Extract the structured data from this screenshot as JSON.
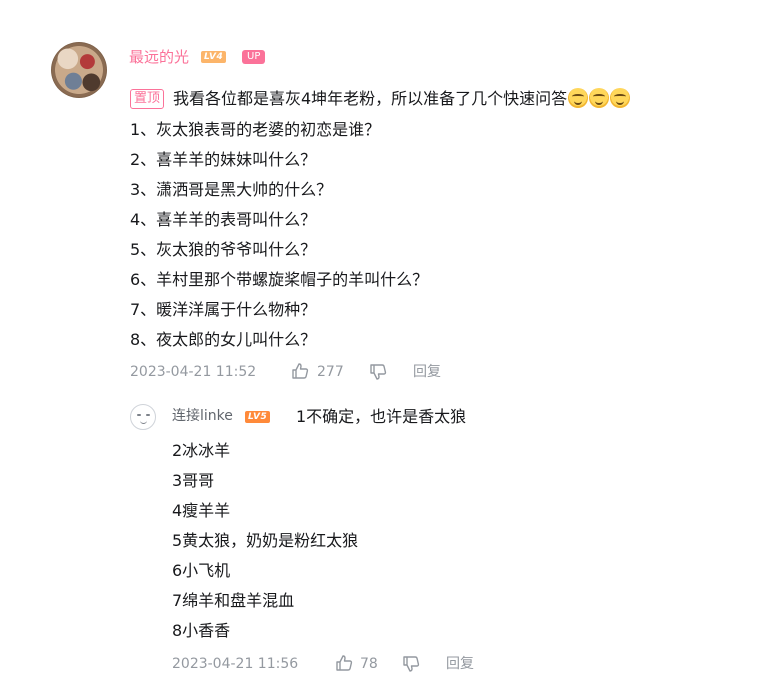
{
  "comment": {
    "username": "最远的光",
    "level": "LV4",
    "up_badge": "UP",
    "pin_label": "置顶",
    "text_lines": [
      "我看各位都是喜灰4坤年老粉，所以准备了几个快速问答",
      "1、灰太狼表哥的老婆的初恋是谁？",
      "2、喜羊羊的妹妹叫什么？",
      "3、潇洒哥是黑大帅的什么？",
      "4、喜羊羊的表哥叫什么？",
      "5、灰太狼的爷爷叫什么？",
      "6、羊村里那个带螺旋桨帽子的羊叫什么？",
      "7、暖洋洋属于什么物种？",
      "8、夜太郎的女儿叫什么？"
    ],
    "timestamp": "2023-04-21 11:52",
    "likes": "277",
    "reply_label": "回复"
  },
  "reply": {
    "username": "连接linke",
    "level": "LV5",
    "text_lines": [
      "1不确定，也许是香太狼",
      "2冰冰羊",
      "3哥哥",
      "4瘦羊羊",
      "5黄太狼，奶奶是粉红太狼",
      "6小飞机",
      "7绵羊和盘羊混血",
      "8小香香"
    ],
    "timestamp": "2023-04-21 11:56",
    "likes": "78",
    "reply_label": "回复"
  },
  "icons": {
    "emoji": "grinning-face-icon",
    "like": "thumbs-up-icon",
    "dislike": "thumbs-down-icon"
  },
  "colors": {
    "username": "#fb7299",
    "meta": "#9499a0",
    "text": "#18191c",
    "level4": "#fcb56a",
    "level5": "#ff8a3a"
  }
}
